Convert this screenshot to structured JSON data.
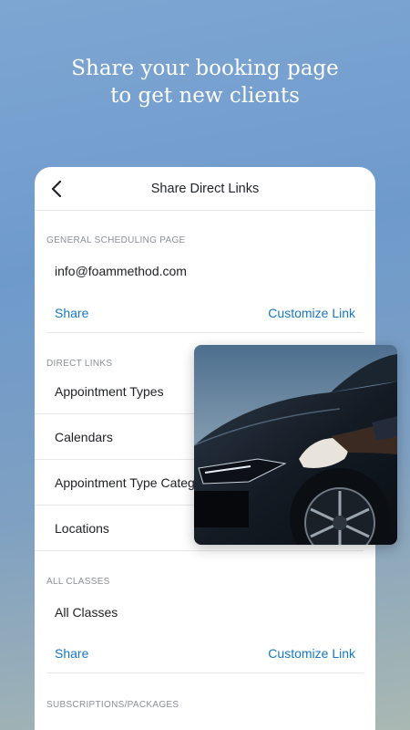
{
  "promo": {
    "headline_line1": "Share your booking page",
    "headline_line2": "to get new clients"
  },
  "header": {
    "title": "Share Direct Links",
    "back_icon": "chevron-left-icon"
  },
  "general": {
    "section_label": "GENERAL SCHEDULING PAGE",
    "email": "info@foammethod.com",
    "share_label": "Share",
    "customize_label": "Customize Link"
  },
  "direct_links": {
    "section_label": "DIRECT LINKS",
    "items": [
      {
        "label": "Appointment Types"
      },
      {
        "label": "Calendars"
      },
      {
        "label": "Appointment Type Categories"
      },
      {
        "label": "Locations"
      }
    ]
  },
  "classes": {
    "section_label": "ALL CLASSES",
    "item_label": "All Classes",
    "share_label": "Share",
    "customize_label": "Customize Link"
  },
  "subscriptions": {
    "section_label": "SUBSCRIPTIONS/PACKAGES"
  },
  "colors": {
    "link": "#1776c5",
    "background_top": "#7ea6d3",
    "background_bottom": "#a9b8b2"
  }
}
